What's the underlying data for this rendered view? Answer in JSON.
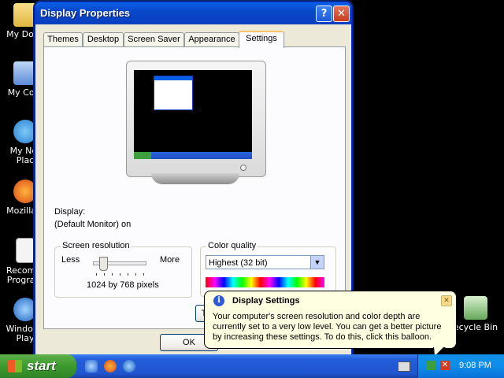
{
  "desktop": {
    "icons": [
      {
        "label_line1": "My Docu",
        "label_line2": ""
      },
      {
        "label_line1": "My Com",
        "label_line2": ""
      },
      {
        "label_line1": "My Net",
        "label_line2": "Plac"
      },
      {
        "label_line1": "Mozilla F",
        "label_line2": ""
      },
      {
        "label_line1": "Recomm",
        "label_line2": "Program"
      },
      {
        "label_line1": "Windows",
        "label_line2": "Play"
      },
      {
        "label_line1": "ecycle Bin",
        "label_line2": ""
      }
    ]
  },
  "dialog": {
    "title": "Display Properties",
    "help_glyph": "?",
    "close_glyph": "✕",
    "tabs": [
      {
        "label": "Themes"
      },
      {
        "label": "Desktop"
      },
      {
        "label": "Screen Saver"
      },
      {
        "label": "Appearance"
      },
      {
        "label": "Settings"
      }
    ],
    "active_tab": "Settings",
    "display_label": "Display:",
    "display_value": "(Default Monitor) on",
    "resolution": {
      "group_title": "Screen resolution",
      "less": "Less",
      "more": "More",
      "value_text": "1024 by 768 pixels",
      "slider_position_fraction": 0.2
    },
    "color_quality": {
      "group_title": "Color quality",
      "selected": "Highest (32 bit)"
    },
    "buttons": {
      "ok": "OK",
      "troubleshoot_partial": "T"
    }
  },
  "balloon": {
    "title": "Display Settings",
    "info_glyph": "i",
    "close_glyph": "✕",
    "text": "Your computer's screen resolution and color depth are currently set to a very low level. You can get a better picture by increasing these settings. To do this, click this balloon."
  },
  "taskbar": {
    "start_label": "start",
    "clock": "9:08 PM"
  },
  "colors": {
    "titlebar": "#0A5FE8",
    "dialog_bg": "#ECE9D8",
    "balloon_bg": "#FFFFE1",
    "taskbar": "#245EDB",
    "start": "#3D9A2F"
  }
}
